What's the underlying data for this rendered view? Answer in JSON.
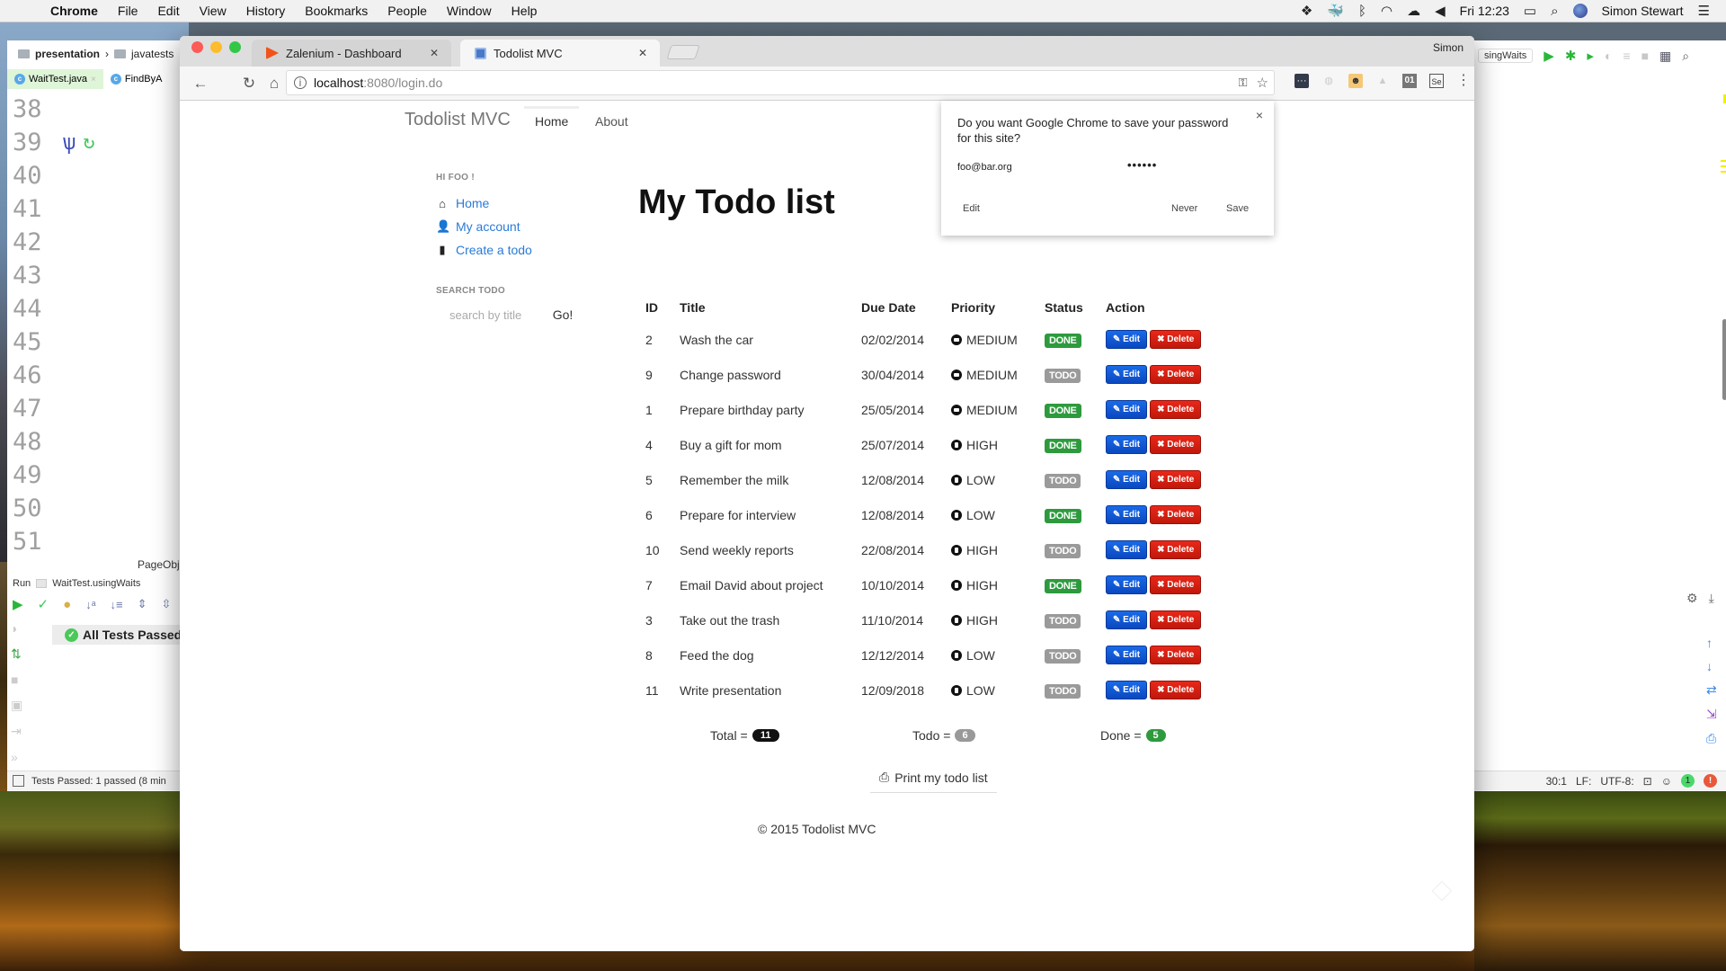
{
  "menubar": {
    "app": "Chrome",
    "items": [
      "File",
      "Edit",
      "View",
      "History",
      "Bookmarks",
      "People",
      "Window",
      "Help"
    ],
    "clock": "Fri 12:23",
    "user": "Simon Stewart"
  },
  "ide": {
    "breadcrumb": [
      "presentation",
      "javatests"
    ],
    "file_tabs": [
      {
        "label": "WaitTest.java",
        "active": true
      },
      {
        "label": "FindByA",
        "active": false
      }
    ],
    "line_numbers": [
      "38",
      "39",
      "40",
      "41",
      "42",
      "43",
      "44",
      "45",
      "46",
      "47",
      "48",
      "49",
      "50",
      "51"
    ],
    "page_obj_label": "PageObj",
    "run_label": "Run",
    "run_config": "WaitTest.usingWaits",
    "all_tests_passed": "All Tests Passed",
    "status_left": "Tests Passed: 1 passed (8 min",
    "run_config_right": "singWaits",
    "status_right": {
      "position": "30:1",
      "line_sep": "LF:",
      "encoding": "UTF-8:",
      "notifications": "1",
      "errors": "!"
    }
  },
  "chrome": {
    "tabs": [
      {
        "title": "Zalenium - Dashboard",
        "active": false
      },
      {
        "title": "Todolist MVC",
        "active": true
      }
    ],
    "profile": "Simon",
    "url_host": "localhost",
    "url_path": ":8080/login.do"
  },
  "password_bubble": {
    "question": "Do you want Google Chrome to save your password for this site?",
    "username": "foo@bar.org",
    "password_mask": "••••••",
    "edit_label": "Edit",
    "never_label": "Never",
    "save_label": "Save"
  },
  "app": {
    "brand": "Todolist MVC",
    "nav": [
      "Home",
      "About"
    ],
    "greeting": "HI FOO !",
    "side_links": [
      {
        "label": "Home",
        "icon": "home-icon"
      },
      {
        "label": "My account",
        "icon": "user-icon"
      },
      {
        "label": "Create a todo",
        "icon": "file-icon"
      }
    ],
    "search_title": "SEARCH TODO",
    "search_placeholder": "search by title",
    "search_button": "Go!",
    "page_title": "My Todo list",
    "table": {
      "columns": [
        "ID",
        "Title",
        "Due Date",
        "Priority",
        "Status",
        "Action"
      ],
      "rows": [
        {
          "id": "2",
          "title": "Wash the car",
          "due": "02/02/2014",
          "priority": "MEDIUM",
          "status": "DONE"
        },
        {
          "id": "9",
          "title": "Change password",
          "due": "30/04/2014",
          "priority": "MEDIUM",
          "status": "TODO"
        },
        {
          "id": "1",
          "title": "Prepare birthday party",
          "due": "25/05/2014",
          "priority": "MEDIUM",
          "status": "DONE"
        },
        {
          "id": "4",
          "title": "Buy a gift for mom",
          "due": "25/07/2014",
          "priority": "HIGH",
          "status": "DONE"
        },
        {
          "id": "5",
          "title": "Remember the milk",
          "due": "12/08/2014",
          "priority": "LOW",
          "status": "TODO"
        },
        {
          "id": "6",
          "title": "Prepare for interview",
          "due": "12/08/2014",
          "priority": "LOW",
          "status": "DONE"
        },
        {
          "id": "10",
          "title": "Send weekly reports",
          "due": "22/08/2014",
          "priority": "HIGH",
          "status": "TODO"
        },
        {
          "id": "7",
          "title": "Email David about project",
          "due": "10/10/2014",
          "priority": "HIGH",
          "status": "DONE"
        },
        {
          "id": "3",
          "title": "Take out the trash",
          "due": "11/10/2014",
          "priority": "HIGH",
          "status": "TODO"
        },
        {
          "id": "8",
          "title": "Feed the dog",
          "due": "12/12/2014",
          "priority": "LOW",
          "status": "TODO"
        },
        {
          "id": "11",
          "title": "Write presentation",
          "due": "12/09/2018",
          "priority": "LOW",
          "status": "TODO"
        }
      ],
      "edit_label": "Edit",
      "delete_label": "Delete"
    },
    "summary": {
      "total_label": "Total =",
      "total": "11",
      "todo_label": "Todo =",
      "todo": "6",
      "done_label": "Done =",
      "done": "5"
    },
    "print_label": "Print my todo list",
    "footer": "© 2015 Todolist MVC"
  },
  "colors": {
    "done": "#2e9a3e",
    "todo": "#9a9a9a",
    "edit": "#0a58d8",
    "delete": "#d8200f",
    "link": "#2a7ad8"
  }
}
